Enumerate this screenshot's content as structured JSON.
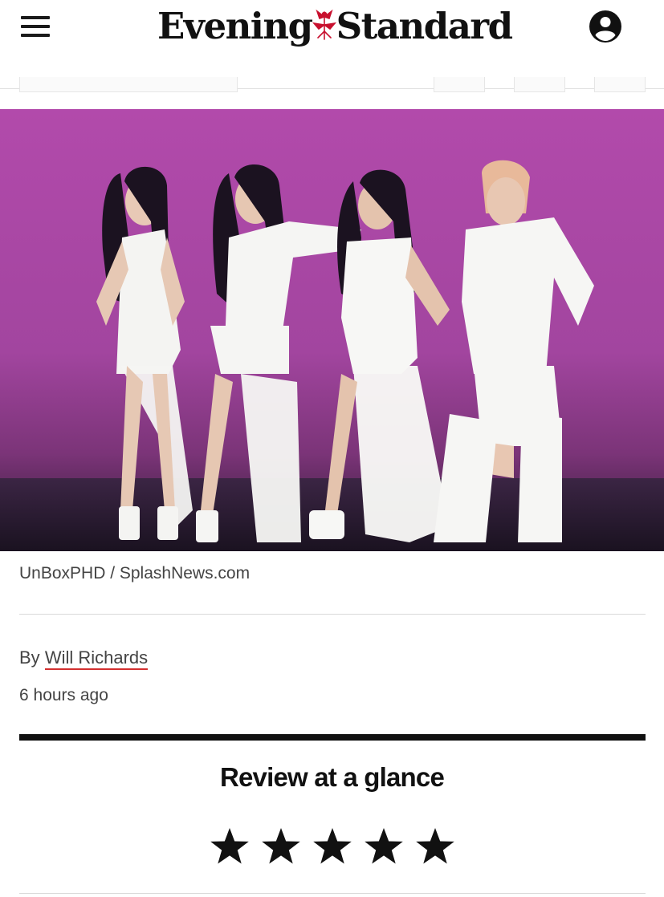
{
  "header": {
    "logo_left": "Evening",
    "logo_right": "Standard",
    "menu_icon": "hamburger-menu-icon",
    "account_icon": "user-account-icon"
  },
  "hero": {
    "description_icon": "concert-photo",
    "background_color": "#b04aa8"
  },
  "article": {
    "photo_credit": "UnBoxPHD / SplashNews.com",
    "byline_prefix": "By",
    "author": "Will Richards",
    "timestamp": "6 hours ago"
  },
  "review": {
    "heading": "Review at a glance",
    "rating": 5,
    "max_rating": 5
  },
  "colors": {
    "text": "#1a1a1a",
    "muted": "#444444",
    "accent_red": "#d32f2f",
    "logo_red": "#c8102e"
  }
}
